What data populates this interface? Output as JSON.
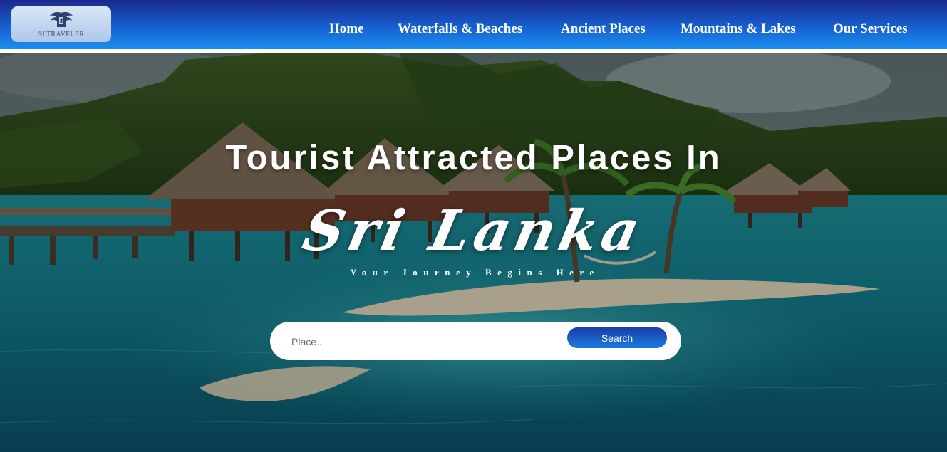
{
  "header": {
    "logo_text": "SLTRAVELER",
    "nav": [
      {
        "label": "Home"
      },
      {
        "label": "Waterfalls & Beaches"
      },
      {
        "label": "Ancient Places"
      },
      {
        "label": "Mountains & Lakes"
      },
      {
        "label": "Our Services"
      }
    ]
  },
  "hero": {
    "title": "Tourist Attracted Places In",
    "brand": "Sri Lanka",
    "tagline": "Your Journey Begins Here",
    "search": {
      "placeholder": "Place..",
      "value": "",
      "button_label": "Search"
    }
  },
  "colors": {
    "header_top": "#1a2a8c",
    "header_bottom": "#1a8ef0",
    "button_top": "#1a3fa8",
    "button_bottom": "#1a7ae0"
  },
  "icons": {
    "logo": "winged-lion-emblem-icon"
  }
}
